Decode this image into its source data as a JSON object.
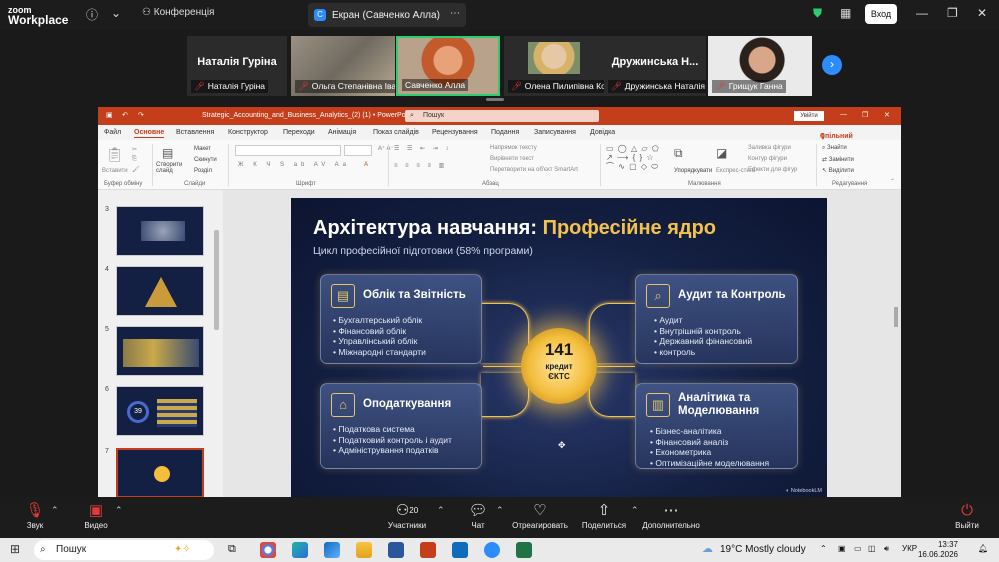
{
  "zoom": {
    "brand_line1": "zoom",
    "brand_line2": "Workplace",
    "conference_label": "Конференція",
    "share_tab_label": "Екран (Савченко Алла)",
    "login_label": "Вход"
  },
  "participants": [
    {
      "name": "Наталія Гуріна",
      "big_label": "Наталія Гуріна"
    },
    {
      "name": "Ольга Степанівна Іван…"
    },
    {
      "name": "Савченко Алла"
    },
    {
      "name": "Олена Пилипівна Колі…"
    },
    {
      "name": "Дружинська Наталія",
      "big_label": "Дружинська Н..."
    },
    {
      "name": "Грищук Ганна"
    }
  ],
  "ppt": {
    "file_title": "Strategic_Accounting_and_Business_Analytics_(2) (1)  •  PowerPoint",
    "search_placeholder": "Пошук",
    "login_label": "Увійти",
    "tabs": [
      "Файл",
      "Основне",
      "Вставлення",
      "Конструктор",
      "Переходи",
      "Анімація",
      "Показ слайдів",
      "Рецензування",
      "Подання",
      "Записування",
      "Довідка"
    ],
    "share_label": "Спільний доступ",
    "ribbon_groups": [
      "Буфер обміну",
      "Слайди",
      "Шрифт",
      "Абзац",
      "Малювання",
      "Редагування"
    ],
    "ribbon_items": {
      "paste": "Вставити",
      "new_slide": "Створити слайд",
      "layout": "Макет",
      "reset": "Скинути",
      "section": "Розділ",
      "text_direction": "Напрямок тексту",
      "align_text": "Вирівняти текст",
      "smartart": "Перетворити на об'єкт SmartArt",
      "arrange": "Упорядкувати",
      "quick_styles": "Експрес-стилі",
      "shape_fill": "Заливка фігури",
      "shape_outline": "Контур фігури",
      "shape_effects": "Ефекти для фігур",
      "find": "Знайти",
      "replace": "Замінити",
      "select": "Виділити"
    },
    "slide_numbers": [
      "3",
      "4",
      "5",
      "6",
      "7"
    ]
  },
  "slide": {
    "title_main": "Архітектура навчання: ",
    "title_highlight": "Професійне ядро",
    "subtitle": "Цикл професійної підготовки (58% програми)",
    "hub_number": "141",
    "hub_line1": "кредит",
    "hub_line2": "ЄКТС",
    "cards": [
      {
        "title": "Облік та Звітність",
        "icon": "report-icon",
        "items": [
          "Бухгалтерський облік",
          "Фінансовий облік",
          "Управлінський облік",
          "Міжнародні стандарти"
        ]
      },
      {
        "title": "Аудит та Контроль",
        "icon": "audit-icon",
        "items": [
          "Аудит",
          "Внутрішній контроль",
          "Державний фінансовий",
          "контроль"
        ]
      },
      {
        "title": "Оподаткування",
        "icon": "tax-building-icon",
        "items": [
          "Податкова система",
          "Податковий контроль і аудит",
          "Адміністрування податків"
        ]
      },
      {
        "title_line1": "Аналітика та",
        "title_line2": "Моделювання",
        "icon": "analytics-icon",
        "items": [
          "Бізнес-аналітика",
          "Фінансовий аналіз",
          "Економетрика",
          "Оптимізаційне моделювання"
        ]
      }
    ],
    "watermark": "NotebookLM",
    "thumb_6_number": "39"
  },
  "controls": {
    "audio": "Звук",
    "video": "Видео",
    "participants": "Участники",
    "participants_count": "20",
    "chat": "Чат",
    "react": "Отреагировать",
    "share": "Поделиться",
    "more": "Дополнительно",
    "leave": "Выйти"
  },
  "taskbar": {
    "search_label": "Пошук",
    "weather": "19°C  Mostly cloudy",
    "lang": "УКР",
    "time": "13:37",
    "date": "16.06.2026"
  },
  "colors": {
    "ppt_accent": "#c43e1c",
    "zoom_blue": "#2d8cff",
    "slide_gold": "#f2c14e",
    "muted_red": "#e03a3a"
  }
}
